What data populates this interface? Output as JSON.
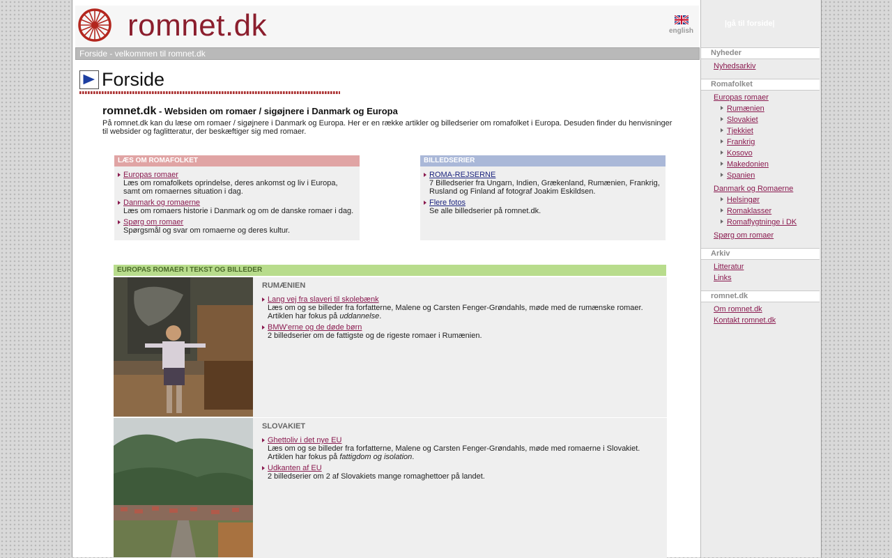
{
  "site": {
    "logo": "romnet.dk",
    "language_link": "english",
    "home_link": "|gå til forside|"
  },
  "breadcrumb": "Forside - velkommen til romnet.dk",
  "page": {
    "title": "Forside",
    "intro_site": "romnet.dk",
    "intro_tagline": " - Websiden om romaer / sigøjnere i Danmark og Europa",
    "intro_text": "På romnet.dk kan du læse om romaer / sigøjnere i Danmark og Europa. Her er en række artikler og billedserier om romafolket i Europa. Desuden finder du henvisninger til websider og faglitteratur, der beskæftiger sig med romaer."
  },
  "box_read": {
    "header": "LÆS OM ROMAFOLKET",
    "items": [
      {
        "link": "Europas romaer",
        "desc": "Læs om romafolkets oprindelse, deres ankomst og liv i Europa, samt om romaernes situation i dag."
      },
      {
        "link": "Danmark og romaerne",
        "desc": "Læs om romaers historie i Danmark og om de danske romaer i dag."
      },
      {
        "link": "Spørg om romaer",
        "desc": "Spørgsmål og svar om romaerne og deres kultur."
      }
    ]
  },
  "box_pics": {
    "header": "BILLEDSERIER",
    "items": [
      {
        "link": "ROMA-REJSERNE",
        "desc": "7 Billedserier fra Ungarn, Indien, Grækenland, Rumænien, Frankrig, Rusland og Finland af fotograf Joakim Eskildsen."
      },
      {
        "link": "Flere fotos",
        "desc": "Se alle billedserier på romnet.dk."
      }
    ]
  },
  "europe": {
    "header": "EUROPAS ROMAER I TEKST OG BILLEDER",
    "sections": [
      {
        "title": "RUMÆNIEN",
        "items": [
          {
            "link": "Lang vej fra slaveri til skolebænk",
            "desc": "Læs om og se billeder fra forfatterne, Malene og Carsten Fenger-Grøndahls, møde med de rumænske romaer.",
            "focus_prefix": "Artiklen har fokus på ",
            "focus": "uddannelse",
            "focus_suffix": "."
          },
          {
            "link": "BMW'erne og de døde børn",
            "desc": "2 billedserier om de fattigste og de rigeste romaer i Rumænien."
          }
        ]
      },
      {
        "title": "SLOVAKIET",
        "items": [
          {
            "link": "Ghettoliv i det nye EU",
            "desc": "Læs om og se billeder fra forfatterne, Malene og Carsten Fenger-Grøndahls, møde med romaerne i Slovakiet.",
            "focus_prefix": "Artiklen har fokus på ",
            "focus": "fattigdom og isolation",
            "focus_suffix": "."
          },
          {
            "link": "Udkanten af EU",
            "desc": "2 billedserier om 2 af Slovakiets mange romaghettoer på landet."
          }
        ]
      }
    ]
  },
  "sidebar": {
    "nyheder": {
      "header": "Nyheder",
      "links": [
        "Nyhedsarkiv"
      ]
    },
    "romafolket": {
      "header": "Romafolket",
      "europas": "Europas romaer",
      "europas_sub": [
        "Rumænien",
        "Slovakiet",
        "Tjekkiet",
        "Frankrig",
        "Kosovo",
        "Makedonien",
        "Spanien"
      ],
      "danmark": "Danmark og Romaerne",
      "danmark_sub": [
        "Helsingør",
        "Romaklasser",
        "Romaflygtninge i DK"
      ],
      "spoerg": "Spørg om romaer"
    },
    "arkiv": {
      "header": "Arkiv",
      "links": [
        "Litteratur",
        "Links"
      ]
    },
    "romnet": {
      "header": "romnet.dk",
      "links": [
        "Om romnet.dk",
        "Kontakt romnet.dk"
      ]
    }
  },
  "colors": {
    "logo": "#8b1e2d",
    "read_header": "#e0a4a4",
    "pics_header": "#aab8d8",
    "europe_header": "#b8dc8c",
    "link": "#8a1a4f"
  }
}
